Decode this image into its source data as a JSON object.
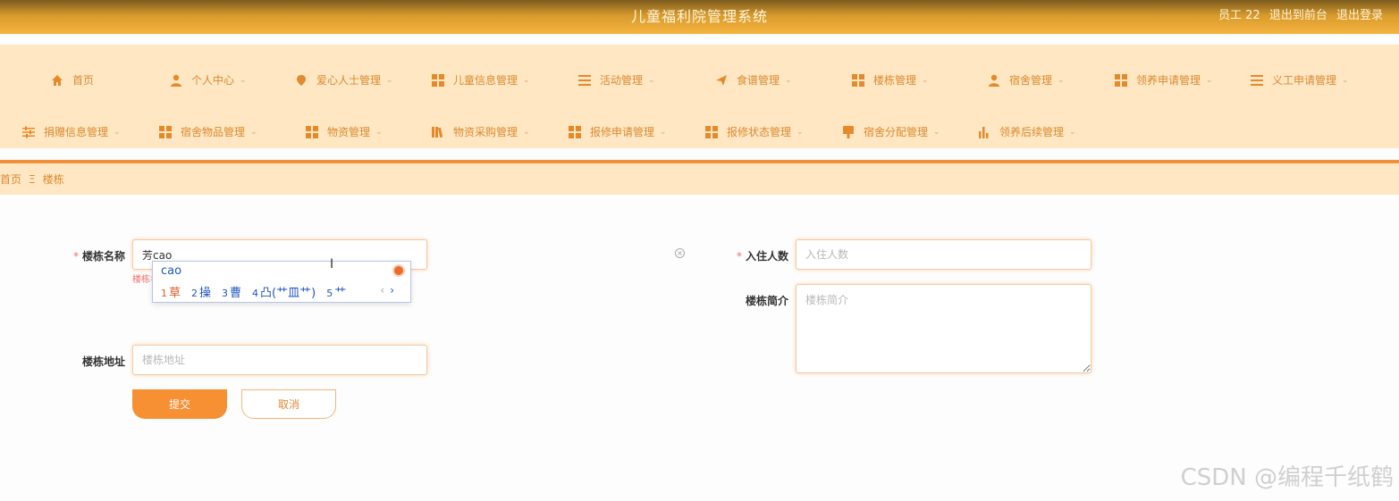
{
  "header": {
    "title": "儿童福利院管理系统",
    "user": "员工 22",
    "to_front": "退出到前台",
    "logout": "退出登录"
  },
  "nav": {
    "row1": [
      {
        "label": "首页",
        "icon": "home-icon",
        "chevron": false
      },
      {
        "label": "个人中心",
        "icon": "user-icon",
        "chevron": true
      },
      {
        "label": "爱心人士管理",
        "icon": "pin-icon",
        "chevron": true
      },
      {
        "label": "儿童信息管理",
        "icon": "grid-icon",
        "chevron": true
      },
      {
        "label": "活动管理",
        "icon": "list-icon",
        "chevron": true
      },
      {
        "label": "食谱管理",
        "icon": "send-icon",
        "chevron": true
      },
      {
        "label": "楼栋管理",
        "icon": "grid-icon",
        "chevron": true
      },
      {
        "label": "宿舍管理",
        "icon": "user-icon",
        "chevron": true
      },
      {
        "label": "领养申请管理",
        "icon": "grid-icon",
        "chevron": true
      },
      {
        "label": "义工申请管理",
        "icon": "list-icon",
        "chevron": true
      }
    ],
    "row2": [
      {
        "label": "捐赠信息管理",
        "icon": "sliders-icon",
        "chevron": true
      },
      {
        "label": "宿舍物品管理",
        "icon": "grid-icon",
        "chevron": true
      },
      {
        "label": "物资管理",
        "icon": "grid-icon",
        "chevron": true
      },
      {
        "label": "物资采购管理",
        "icon": "books-icon",
        "chevron": true
      },
      {
        "label": "报修申请管理",
        "icon": "grid-icon",
        "chevron": true
      },
      {
        "label": "报修状态管理",
        "icon": "grid-icon",
        "chevron": true
      },
      {
        "label": "宿舍分配管理",
        "icon": "brush-icon",
        "chevron": true
      },
      {
        "label": "领养后续管理",
        "icon": "bar-chart-icon",
        "chevron": true
      }
    ]
  },
  "breadcrumb": {
    "home": "首页",
    "separator": "Ξ",
    "current": "楼栋"
  },
  "form": {
    "building_name_label": "楼栋名称",
    "building_name_value": "芳cao",
    "building_name_error": "楼栋名",
    "residents_label": "入住人数",
    "residents_placeholder": "入住人数",
    "intro_label": "楼栋简介",
    "intro_placeholder": "楼栋简介",
    "address_label": "楼栋地址",
    "address_placeholder": "楼栋地址",
    "required_mark": "*",
    "submit": "提交",
    "cancel": "取消"
  },
  "ime": {
    "composition": "cao",
    "candidates": [
      {
        "n": "1",
        "text": "草"
      },
      {
        "n": "2",
        "text": "操"
      },
      {
        "n": "3",
        "text": "曹"
      },
      {
        "n": "4",
        "text": "凸(艹皿艹)"
      },
      {
        "n": "5",
        "text": "艹"
      }
    ],
    "prev": "‹",
    "next": "›"
  },
  "watermark": "CSDN @编程千纸鹤",
  "colors": {
    "accent": "#f78f33",
    "nav_bg": "#ffe7c4",
    "nav_text": "#d98a2e",
    "error": "#f56c6c"
  }
}
